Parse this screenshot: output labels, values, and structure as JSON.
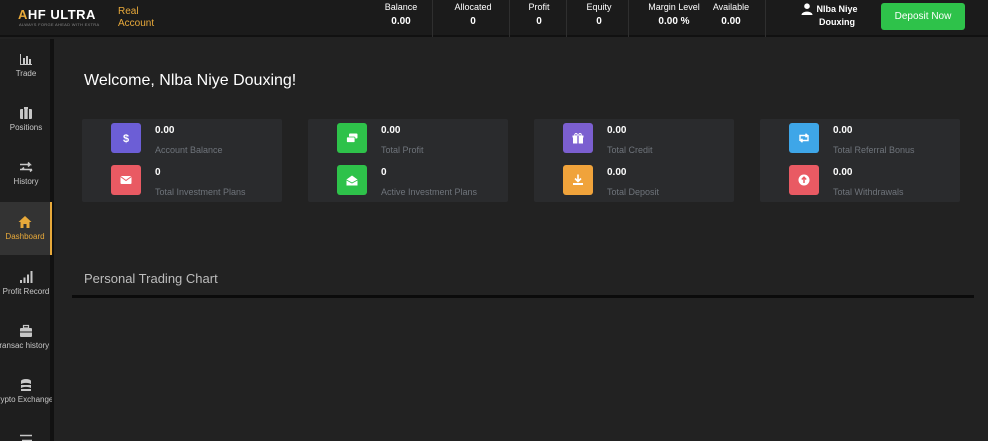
{
  "header": {
    "logo_main": "HF ULTRA",
    "logo_mark": "A",
    "logo_sub": "ALWAYS FORGE AHEAD WITH EXTRA",
    "account_type": "Real Account",
    "stats": [
      {
        "label": "Balance",
        "value": "0.00"
      },
      {
        "label": "Allocated",
        "value": "0"
      },
      {
        "label": "Profit",
        "value": "0"
      },
      {
        "label": "Equity",
        "value": "0"
      },
      {
        "label": "Margin Level",
        "value": "0.00 %"
      },
      {
        "label": "Available",
        "value": "0.00"
      }
    ],
    "user_name": "Nlba Niye Douxing",
    "deposit_label": "Deposit Now"
  },
  "sidebar": {
    "items": [
      {
        "label": "Trade",
        "icon": "bar-chart-icon"
      },
      {
        "label": "Positions",
        "icon": "briefcase-icon"
      },
      {
        "label": "History",
        "icon": "exchange-arrows-icon"
      },
      {
        "label": "Dashboard",
        "icon": "home-icon",
        "active": true
      },
      {
        "label": "Profit Record",
        "icon": "signal-bars-icon"
      },
      {
        "label": "Transac history",
        "icon": "toolbox-icon"
      },
      {
        "label": "Crypto Exchange",
        "icon": "coins-icon"
      }
    ]
  },
  "main": {
    "welcome": "Welcome, Nlba Niye Douxing!",
    "cards": [
      {
        "top": {
          "value": "0.00",
          "label": "Account Balance",
          "icon": "dollar-icon",
          "color": "#6c5ed6"
        },
        "bottom": {
          "value": "0",
          "label": "Total Investment Plans",
          "icon": "envelope-icon",
          "color": "#e95a63"
        }
      },
      {
        "top": {
          "value": "0.00",
          "label": "Total Profit",
          "icon": "money-icon",
          "color": "#2ec24a"
        },
        "bottom": {
          "value": "0",
          "label": "Active Investment Plans",
          "icon": "open-envelope-icon",
          "color": "#2ec24a"
        }
      },
      {
        "top": {
          "value": "0.00",
          "label": "Total Credit",
          "icon": "gift-icon",
          "color": "#7b5fd0"
        },
        "bottom": {
          "value": "0.00",
          "label": "Total Deposit",
          "icon": "download-icon",
          "color": "#f0a33b"
        }
      },
      {
        "top": {
          "value": "0.00",
          "label": "Total Referral Bonus",
          "icon": "retweet-icon",
          "color": "#3ea6e8"
        },
        "bottom": {
          "value": "0.00",
          "label": "Total Withdrawals",
          "icon": "arrow-circle-icon",
          "color": "#e95a63"
        }
      }
    ],
    "chart_title": "Personal Trading Chart"
  }
}
